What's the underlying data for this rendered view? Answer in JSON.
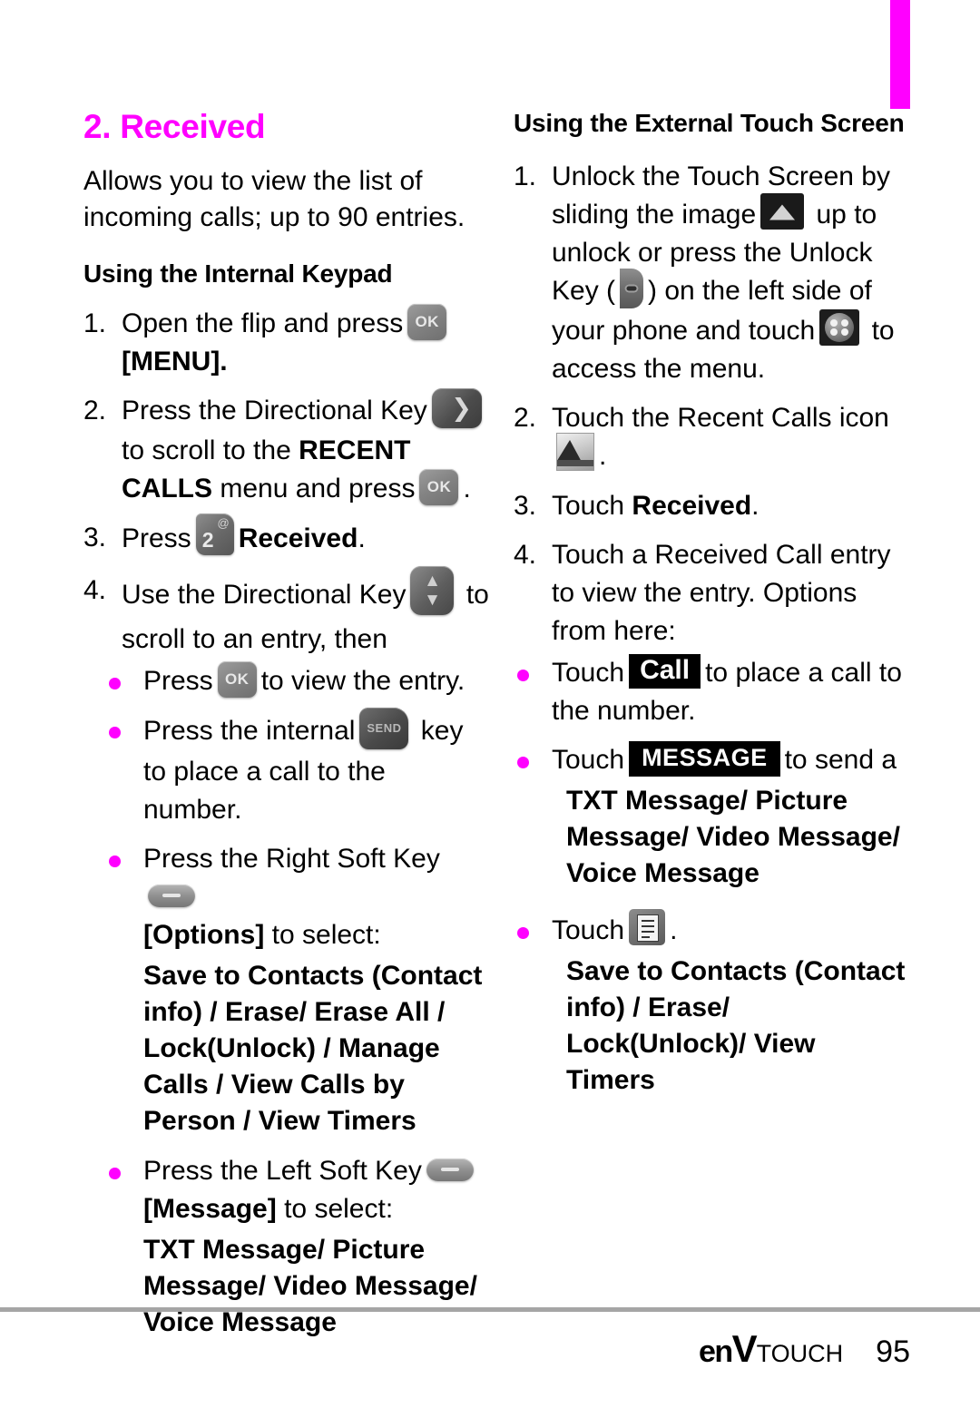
{
  "colors": {
    "accent": "#ff00ff",
    "rule": "#a5a5a5",
    "text": "#000000"
  },
  "edge_tab": {
    "name": "chapter-tab"
  },
  "left_column": {
    "section_title": "2. Received",
    "intro": "Allows you to view the list of incoming calls; up to 90 entries.",
    "subhead": "Using the Internal Keypad",
    "steps": [
      {
        "num": "1.",
        "text_a": "Open the flip and press",
        "icon": "ok-key",
        "icon_label": "OK",
        "text_b": "[MENU].",
        "menu_bold": "MENU"
      },
      {
        "num": "2.",
        "text_a": "Press the Directional Key",
        "icon": "directional-right-key",
        "text_b": "to scroll to the",
        "bold": "RECENT CALLS",
        "text_c": "menu and press",
        "icon2": "ok-key",
        "icon2_label": "OK",
        "text_d": "."
      },
      {
        "num": "3.",
        "text_a": "Press",
        "icon": "keypad-2-key",
        "icon_digit": "2",
        "icon_alt": "@",
        "bold": "Received",
        "text_b": "."
      },
      {
        "num": "4.",
        "text_a": "Use the Directional Key",
        "icon": "directional-updown-key",
        "text_b": "to scroll to an entry, then"
      }
    ],
    "bullets": [
      {
        "text_a": "Press",
        "icon": "ok-key",
        "icon_label": "OK",
        "text_b": "to view the entry."
      },
      {
        "text_a": "Press the internal",
        "icon": "send-key",
        "icon_label": "SEND",
        "text_b": "key to place a call to the number."
      },
      {
        "text_a": "Press the Right Soft Key",
        "icon": "right-soft-key",
        "text_b": "[Options] to select:",
        "bracket_bold": "Options",
        "options": "Save to Contacts (Contact info) / Erase/ Erase All / Lock(Unlock) / Manage Calls / View Calls by Person / View Timers"
      },
      {
        "text_a": "Press the Left Soft Key",
        "icon": "left-soft-key",
        "text_b": "[Message] to select:",
        "bracket_bold": "Message",
        "options": "TXT Message/ Picture Message/ Video Message/ Voice Message"
      }
    ]
  },
  "right_column": {
    "subhead": "Using the External Touch Screen",
    "steps": [
      {
        "num": "1.",
        "text_a": "Unlock the Touch Screen by sliding the image",
        "icon": "slide-up-unlock-image",
        "text_b": "up to unlock or press the Unlock Key (",
        "icon2": "unlock-side-key",
        "text_c": ") on the left side of your phone and touch",
        "icon3": "menu-grid-icon",
        "text_d": "to access the menu."
      },
      {
        "num": "2.",
        "text_a": "Touch the Recent Calls icon",
        "icon": "recent-calls-icon",
        "text_b": "."
      },
      {
        "num": "3.",
        "text_a": "Touch",
        "bold": "Received",
        "text_b": "."
      },
      {
        "num": "4.",
        "text_a": "Touch a Received Call entry to view the entry. Options from here:"
      }
    ],
    "bullets": [
      {
        "text_a": "Touch",
        "button": "Call",
        "text_b": "to place a call to the number."
      },
      {
        "text_a": "Touch",
        "button": "MESSAGE",
        "text_b": "to send a",
        "options": "TXT Message/ Picture Message/ Video Message/ Voice Message"
      },
      {
        "text_a": "Touch",
        "icon": "view-list-icon",
        "text_b": ".",
        "options": "Save to Contacts (Contact info) / Erase/ Lock(Unlock)/ View Timers"
      }
    ]
  },
  "footer": {
    "logo_en": "en",
    "logo_v": "V",
    "logo_touch": "TOUCH",
    "page_number": "95"
  }
}
